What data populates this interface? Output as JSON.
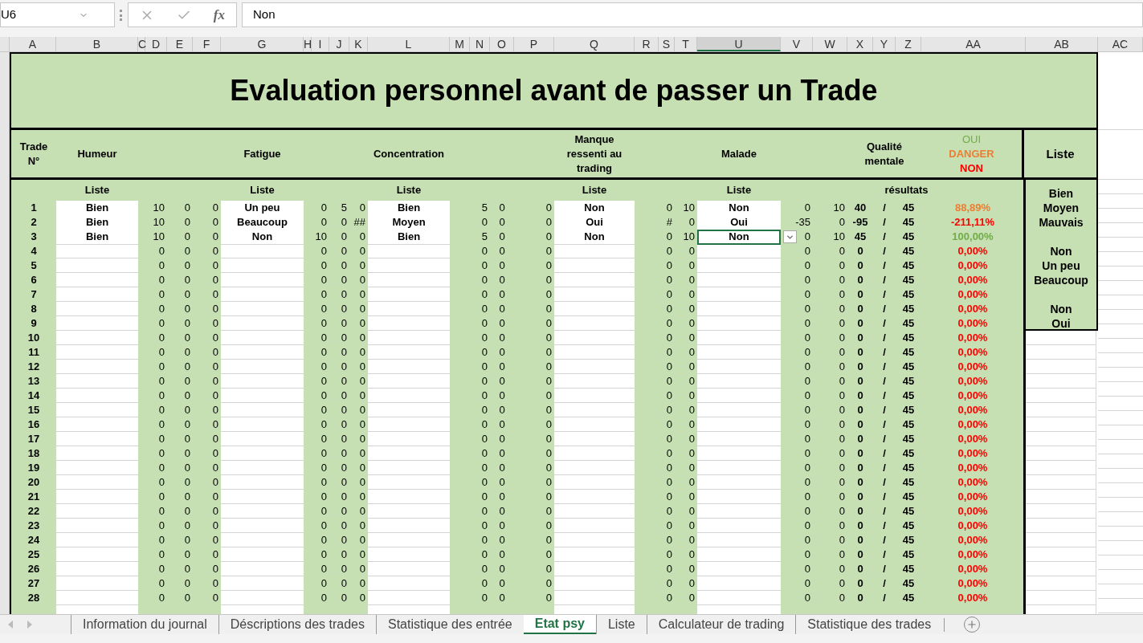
{
  "name_box": "U6",
  "formula_icon": "fx",
  "formula": "Non",
  "columns": [
    {
      "label": "A",
      "selected": false
    },
    {
      "label": "B",
      "selected": false
    },
    {
      "label": "C",
      "selected": false
    },
    {
      "label": "D",
      "selected": false
    },
    {
      "label": "E",
      "selected": false
    },
    {
      "label": "F",
      "selected": false
    },
    {
      "label": "G",
      "selected": false
    },
    {
      "label": "H",
      "selected": false
    },
    {
      "label": "I",
      "selected": false
    },
    {
      "label": "J",
      "selected": false
    },
    {
      "label": "K",
      "selected": false
    },
    {
      "label": "L",
      "selected": false
    },
    {
      "label": "M",
      "selected": false
    },
    {
      "label": "N",
      "selected": false
    },
    {
      "label": "O",
      "selected": false
    },
    {
      "label": "P",
      "selected": false
    },
    {
      "label": "Q",
      "selected": false
    },
    {
      "label": "R",
      "selected": false
    },
    {
      "label": "S",
      "selected": false
    },
    {
      "label": "T",
      "selected": false
    },
    {
      "label": "U",
      "selected": true
    },
    {
      "label": "V",
      "selected": false
    },
    {
      "label": "W",
      "selected": false
    },
    {
      "label": "X",
      "selected": false
    },
    {
      "label": "Y",
      "selected": false
    },
    {
      "label": "Z",
      "selected": false
    },
    {
      "label": "AA",
      "selected": false
    },
    {
      "label": "AB",
      "selected": false
    },
    {
      "label": "AC",
      "selected": false
    }
  ],
  "title": "Evaluation personnel avant de passer un Trade",
  "headers": {
    "trade": "Trade N°",
    "humeur": "Humeur",
    "fatigue": "Fatigue",
    "concentration": "Concentration",
    "manque": "Manque ressenti au trading",
    "malade": "Malade",
    "qualite": "Qualité mentale",
    "legend": [
      {
        "label": "OUI",
        "color": "#70ad47"
      },
      {
        "label": "DANGER",
        "color": "#ed7d31"
      },
      {
        "label": "NON",
        "color": "#ff0000"
      }
    ],
    "liste": "Liste"
  },
  "subheaders": {
    "humeur": "Liste",
    "fatigue": "Liste",
    "concentration": "Liste",
    "manque": "Liste",
    "malade": "Liste",
    "resultats": "résultats"
  },
  "rows": [
    {
      "trade": "1",
      "humeur": "Bien",
      "humeur_scores": [
        "10",
        "0",
        "0"
      ],
      "fatigue": "Un peu",
      "fatigue_scores": [
        "0",
        "5",
        "0"
      ],
      "concentration": "Bien",
      "concentration_scores": [
        "5",
        "0",
        "0"
      ],
      "manque": "Non",
      "manque_scores": [
        "0",
        "10"
      ],
      "malade": "Non",
      "malade_selected": false,
      "malade_scores": [
        "0",
        "10"
      ],
      "total": "40",
      "separator": "/",
      "max": "45",
      "result": "88,89%",
      "color": "#ed7d31"
    },
    {
      "trade": "2",
      "humeur": "Bien",
      "humeur_scores": [
        "10",
        "0",
        "0"
      ],
      "fatigue": "Beaucoup",
      "fatigue_scores": [
        "0",
        "0",
        "##"
      ],
      "concentration": "Moyen",
      "concentration_scores": [
        "0",
        "0",
        "0"
      ],
      "manque": "Oui",
      "manque_scores": [
        "#",
        "0"
      ],
      "malade": "Oui",
      "malade_selected": false,
      "malade_scores": [
        "-35",
        "0"
      ],
      "total": "-95",
      "separator": "/",
      "max": "45",
      "result": "-211,11%",
      "color": "#ff0000"
    },
    {
      "trade": "3",
      "humeur": "Bien",
      "humeur_scores": [
        "10",
        "0",
        "0"
      ],
      "fatigue": "Non",
      "fatigue_scores": [
        "10",
        "0",
        "0"
      ],
      "concentration": "Bien",
      "concentration_scores": [
        "5",
        "0",
        "0"
      ],
      "manque": "Non",
      "manque_scores": [
        "0",
        "10"
      ],
      "malade": "Non",
      "malade_selected": true,
      "malade_scores": [
        "0",
        "10"
      ],
      "total": "45",
      "separator": "/",
      "max": "45",
      "result": "100,00%",
      "color": "#70ad47"
    },
    {
      "trade": "4",
      "humeur_scores": [
        "0",
        "0",
        "0"
      ],
      "fatigue_scores": [
        "0",
        "0",
        "0"
      ],
      "concentration_scores": [
        "0",
        "0",
        "0"
      ],
      "manque_scores": [
        "0",
        "0"
      ],
      "malade_selected": false,
      "malade_scores": [
        "0",
        "0"
      ],
      "total": "0",
      "separator": "/",
      "max": "45",
      "result": "0,00%",
      "color": "#ff0000"
    },
    {
      "trade": "5",
      "humeur_scores": [
        "0",
        "0",
        "0"
      ],
      "fatigue_scores": [
        "0",
        "0",
        "0"
      ],
      "concentration_scores": [
        "0",
        "0",
        "0"
      ],
      "manque_scores": [
        "0",
        "0"
      ],
      "malade_selected": false,
      "malade_scores": [
        "0",
        "0"
      ],
      "total": "0",
      "separator": "/",
      "max": "45",
      "result": "0,00%",
      "color": "#ff0000"
    },
    {
      "trade": "6",
      "humeur_scores": [
        "0",
        "0",
        "0"
      ],
      "fatigue_scores": [
        "0",
        "0",
        "0"
      ],
      "concentration_scores": [
        "0",
        "0",
        "0"
      ],
      "manque_scores": [
        "0",
        "0"
      ],
      "malade_selected": false,
      "malade_scores": [
        "0",
        "0"
      ],
      "total": "0",
      "separator": "/",
      "max": "45",
      "result": "0,00%",
      "color": "#ff0000"
    },
    {
      "trade": "7",
      "humeur_scores": [
        "0",
        "0",
        "0"
      ],
      "fatigue_scores": [
        "0",
        "0",
        "0"
      ],
      "concentration_scores": [
        "0",
        "0",
        "0"
      ],
      "manque_scores": [
        "0",
        "0"
      ],
      "malade_selected": false,
      "malade_scores": [
        "0",
        "0"
      ],
      "total": "0",
      "separator": "/",
      "max": "45",
      "result": "0,00%",
      "color": "#ff0000"
    },
    {
      "trade": "8",
      "humeur_scores": [
        "0",
        "0",
        "0"
      ],
      "fatigue_scores": [
        "0",
        "0",
        "0"
      ],
      "concentration_scores": [
        "0",
        "0",
        "0"
      ],
      "manque_scores": [
        "0",
        "0"
      ],
      "malade_selected": false,
      "malade_scores": [
        "0",
        "0"
      ],
      "total": "0",
      "separator": "/",
      "max": "45",
      "result": "0,00%",
      "color": "#ff0000"
    },
    {
      "trade": "9",
      "humeur_scores": [
        "0",
        "0",
        "0"
      ],
      "fatigue_scores": [
        "0",
        "0",
        "0"
      ],
      "concentration_scores": [
        "0",
        "0",
        "0"
      ],
      "manque_scores": [
        "0",
        "0"
      ],
      "malade_selected": false,
      "malade_scores": [
        "0",
        "0"
      ],
      "total": "0",
      "separator": "/",
      "max": "45",
      "result": "0,00%",
      "color": "#ff0000"
    },
    {
      "trade": "10",
      "humeur_scores": [
        "0",
        "0",
        "0"
      ],
      "fatigue_scores": [
        "0",
        "0",
        "0"
      ],
      "concentration_scores": [
        "0",
        "0",
        "0"
      ],
      "manque_scores": [
        "0",
        "0"
      ],
      "malade_selected": false,
      "malade_scores": [
        "0",
        "0"
      ],
      "total": "0",
      "separator": "/",
      "max": "45",
      "result": "0,00%",
      "color": "#ff0000"
    },
    {
      "trade": "11",
      "humeur_scores": [
        "0",
        "0",
        "0"
      ],
      "fatigue_scores": [
        "0",
        "0",
        "0"
      ],
      "concentration_scores": [
        "0",
        "0",
        "0"
      ],
      "manque_scores": [
        "0",
        "0"
      ],
      "malade_selected": false,
      "malade_scores": [
        "0",
        "0"
      ],
      "total": "0",
      "separator": "/",
      "max": "45",
      "result": "0,00%",
      "color": "#ff0000"
    },
    {
      "trade": "12",
      "humeur_scores": [
        "0",
        "0",
        "0"
      ],
      "fatigue_scores": [
        "0",
        "0",
        "0"
      ],
      "concentration_scores": [
        "0",
        "0",
        "0"
      ],
      "manque_scores": [
        "0",
        "0"
      ],
      "malade_selected": false,
      "malade_scores": [
        "0",
        "0"
      ],
      "total": "0",
      "separator": "/",
      "max": "45",
      "result": "0,00%",
      "color": "#ff0000"
    },
    {
      "trade": "13",
      "humeur_scores": [
        "0",
        "0",
        "0"
      ],
      "fatigue_scores": [
        "0",
        "0",
        "0"
      ],
      "concentration_scores": [
        "0",
        "0",
        "0"
      ],
      "manque_scores": [
        "0",
        "0"
      ],
      "malade_selected": false,
      "malade_scores": [
        "0",
        "0"
      ],
      "total": "0",
      "separator": "/",
      "max": "45",
      "result": "0,00%",
      "color": "#ff0000"
    },
    {
      "trade": "14",
      "humeur_scores": [
        "0",
        "0",
        "0"
      ],
      "fatigue_scores": [
        "0",
        "0",
        "0"
      ],
      "concentration_scores": [
        "0",
        "0",
        "0"
      ],
      "manque_scores": [
        "0",
        "0"
      ],
      "malade_selected": false,
      "malade_scores": [
        "0",
        "0"
      ],
      "total": "0",
      "separator": "/",
      "max": "45",
      "result": "0,00%",
      "color": "#ff0000"
    },
    {
      "trade": "15",
      "humeur_scores": [
        "0",
        "0",
        "0"
      ],
      "fatigue_scores": [
        "0",
        "0",
        "0"
      ],
      "concentration_scores": [
        "0",
        "0",
        "0"
      ],
      "manque_scores": [
        "0",
        "0"
      ],
      "malade_selected": false,
      "malade_scores": [
        "0",
        "0"
      ],
      "total": "0",
      "separator": "/",
      "max": "45",
      "result": "0,00%",
      "color": "#ff0000"
    },
    {
      "trade": "16",
      "humeur_scores": [
        "0",
        "0",
        "0"
      ],
      "fatigue_scores": [
        "0",
        "0",
        "0"
      ],
      "concentration_scores": [
        "0",
        "0",
        "0"
      ],
      "manque_scores": [
        "0",
        "0"
      ],
      "malade_selected": false,
      "malade_scores": [
        "0",
        "0"
      ],
      "total": "0",
      "separator": "/",
      "max": "45",
      "result": "0,00%",
      "color": "#ff0000"
    },
    {
      "trade": "17",
      "humeur_scores": [
        "0",
        "0",
        "0"
      ],
      "fatigue_scores": [
        "0",
        "0",
        "0"
      ],
      "concentration_scores": [
        "0",
        "0",
        "0"
      ],
      "manque_scores": [
        "0",
        "0"
      ],
      "malade_selected": false,
      "malade_scores": [
        "0",
        "0"
      ],
      "total": "0",
      "separator": "/",
      "max": "45",
      "result": "0,00%",
      "color": "#ff0000"
    },
    {
      "trade": "18",
      "humeur_scores": [
        "0",
        "0",
        "0"
      ],
      "fatigue_scores": [
        "0",
        "0",
        "0"
      ],
      "concentration_scores": [
        "0",
        "0",
        "0"
      ],
      "manque_scores": [
        "0",
        "0"
      ],
      "malade_selected": false,
      "malade_scores": [
        "0",
        "0"
      ],
      "total": "0",
      "separator": "/",
      "max": "45",
      "result": "0,00%",
      "color": "#ff0000"
    },
    {
      "trade": "19",
      "humeur_scores": [
        "0",
        "0",
        "0"
      ],
      "fatigue_scores": [
        "0",
        "0",
        "0"
      ],
      "concentration_scores": [
        "0",
        "0",
        "0"
      ],
      "manque_scores": [
        "0",
        "0"
      ],
      "malade_selected": false,
      "malade_scores": [
        "0",
        "0"
      ],
      "total": "0",
      "separator": "/",
      "max": "45",
      "result": "0,00%",
      "color": "#ff0000"
    },
    {
      "trade": "20",
      "humeur_scores": [
        "0",
        "0",
        "0"
      ],
      "fatigue_scores": [
        "0",
        "0",
        "0"
      ],
      "concentration_scores": [
        "0",
        "0",
        "0"
      ],
      "manque_scores": [
        "0",
        "0"
      ],
      "malade_selected": false,
      "malade_scores": [
        "0",
        "0"
      ],
      "total": "0",
      "separator": "/",
      "max": "45",
      "result": "0,00%",
      "color": "#ff0000"
    },
    {
      "trade": "21",
      "humeur_scores": [
        "0",
        "0",
        "0"
      ],
      "fatigue_scores": [
        "0",
        "0",
        "0"
      ],
      "concentration_scores": [
        "0",
        "0",
        "0"
      ],
      "manque_scores": [
        "0",
        "0"
      ],
      "malade_selected": false,
      "malade_scores": [
        "0",
        "0"
      ],
      "total": "0",
      "separator": "/",
      "max": "45",
      "result": "0,00%",
      "color": "#ff0000"
    },
    {
      "trade": "22",
      "humeur_scores": [
        "0",
        "0",
        "0"
      ],
      "fatigue_scores": [
        "0",
        "0",
        "0"
      ],
      "concentration_scores": [
        "0",
        "0",
        "0"
      ],
      "manque_scores": [
        "0",
        "0"
      ],
      "malade_selected": false,
      "malade_scores": [
        "0",
        "0"
      ],
      "total": "0",
      "separator": "/",
      "max": "45",
      "result": "0,00%",
      "color": "#ff0000"
    },
    {
      "trade": "23",
      "humeur_scores": [
        "0",
        "0",
        "0"
      ],
      "fatigue_scores": [
        "0",
        "0",
        "0"
      ],
      "concentration_scores": [
        "0",
        "0",
        "0"
      ],
      "manque_scores": [
        "0",
        "0"
      ],
      "malade_selected": false,
      "malade_scores": [
        "0",
        "0"
      ],
      "total": "0",
      "separator": "/",
      "max": "45",
      "result": "0,00%",
      "color": "#ff0000"
    },
    {
      "trade": "24",
      "humeur_scores": [
        "0",
        "0",
        "0"
      ],
      "fatigue_scores": [
        "0",
        "0",
        "0"
      ],
      "concentration_scores": [
        "0",
        "0",
        "0"
      ],
      "manque_scores": [
        "0",
        "0"
      ],
      "malade_selected": false,
      "malade_scores": [
        "0",
        "0"
      ],
      "total": "0",
      "separator": "/",
      "max": "45",
      "result": "0,00%",
      "color": "#ff0000"
    },
    {
      "trade": "25",
      "humeur_scores": [
        "0",
        "0",
        "0"
      ],
      "fatigue_scores": [
        "0",
        "0",
        "0"
      ],
      "concentration_scores": [
        "0",
        "0",
        "0"
      ],
      "manque_scores": [
        "0",
        "0"
      ],
      "malade_selected": false,
      "malade_scores": [
        "0",
        "0"
      ],
      "total": "0",
      "separator": "/",
      "max": "45",
      "result": "0,00%",
      "color": "#ff0000"
    },
    {
      "trade": "26",
      "humeur_scores": [
        "0",
        "0",
        "0"
      ],
      "fatigue_scores": [
        "0",
        "0",
        "0"
      ],
      "concentration_scores": [
        "0",
        "0",
        "0"
      ],
      "manque_scores": [
        "0",
        "0"
      ],
      "malade_selected": false,
      "malade_scores": [
        "0",
        "0"
      ],
      "total": "0",
      "separator": "/",
      "max": "45",
      "result": "0,00%",
      "color": "#ff0000"
    },
    {
      "trade": "27",
      "humeur_scores": [
        "0",
        "0",
        "0"
      ],
      "fatigue_scores": [
        "0",
        "0",
        "0"
      ],
      "concentration_scores": [
        "0",
        "0",
        "0"
      ],
      "manque_scores": [
        "0",
        "0"
      ],
      "malade_selected": false,
      "malade_scores": [
        "0",
        "0"
      ],
      "total": "0",
      "separator": "/",
      "max": "45",
      "result": "0,00%",
      "color": "#ff0000"
    },
    {
      "trade": "28",
      "humeur_scores": [
        "0",
        "0",
        "0"
      ],
      "fatigue_scores": [
        "0",
        "0",
        "0"
      ],
      "concentration_scores": [
        "0",
        "0",
        "0"
      ],
      "manque_scores": [
        "0",
        "0"
      ],
      "malade_selected": false,
      "malade_scores": [
        "0",
        "0"
      ],
      "total": "0",
      "separator": "/",
      "max": "45",
      "result": "0,00%",
      "color": "#ff0000"
    }
  ],
  "liste_groups": [
    [
      "Bien",
      "Moyen",
      "Mauvais"
    ],
    [
      "Non",
      "Un peu",
      "Beaucoup"
    ],
    [
      "Non",
      "Oui"
    ]
  ],
  "sheet_tabs": [
    {
      "label": "Information du journal",
      "selected": false
    },
    {
      "label": "Déscriptions des trades",
      "selected": false
    },
    {
      "label": "Statistique des entrée",
      "selected": false
    },
    {
      "label": "Etat psy",
      "selected": true
    },
    {
      "label": "Liste",
      "selected": false
    },
    {
      "label": "Calculateur de trading",
      "selected": false
    },
    {
      "label": "Statistique des trades",
      "selected": false
    }
  ]
}
